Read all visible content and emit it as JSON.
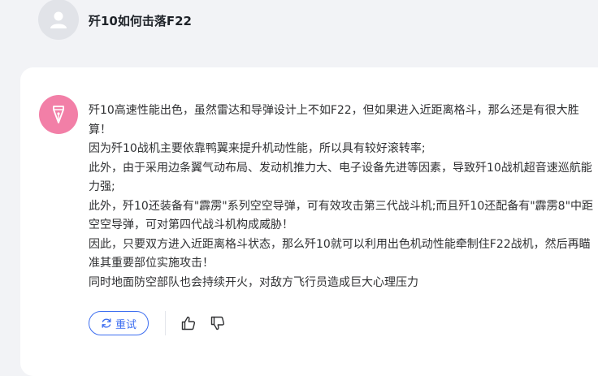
{
  "question": {
    "text": "歼10如何击落F22"
  },
  "answer": {
    "paragraphs": [
      "歼10高速性能出色，虽然雷达和导弹设计上不如F22，但如果进入近距离格斗，那么还是有很大胜算！",
      "因为歼10战机主要依靠鸭翼来提升机动性能，所以具有较好滚转率;",
      "此外，由于采用边条翼气动布局、发动机推力大、电子设备先进等因素，导致歼10战机超音速巡航能力强;",
      "此外，歼10还装备有\"霹雳\"系列空空导弹，可有效攻击第三代战斗机;而且歼10还配备有\"霹雳8\"中距空空导弹，可对第四代战斗机构成威胁！",
      "因此，只要双方进入近距离格斗状态，那么歼10就可以利用出色机动性能牵制住F22战机，然后再瞄准其重要部位实施攻击！",
      "同时地面防空部队也会持续开火，对敌方飞行员造成巨大心理压力"
    ]
  },
  "actions": {
    "retry_label": "重试"
  },
  "icons": {
    "user": "user-avatar-icon",
    "bot": "pen-nib-icon",
    "retry": "refresh-icon",
    "like": "thumbs-up-icon",
    "dislike": "thumbs-down-icon"
  },
  "colors": {
    "accent": "#3d6ef0",
    "bot_avatar": "#f27fa7",
    "text": "#303133"
  }
}
